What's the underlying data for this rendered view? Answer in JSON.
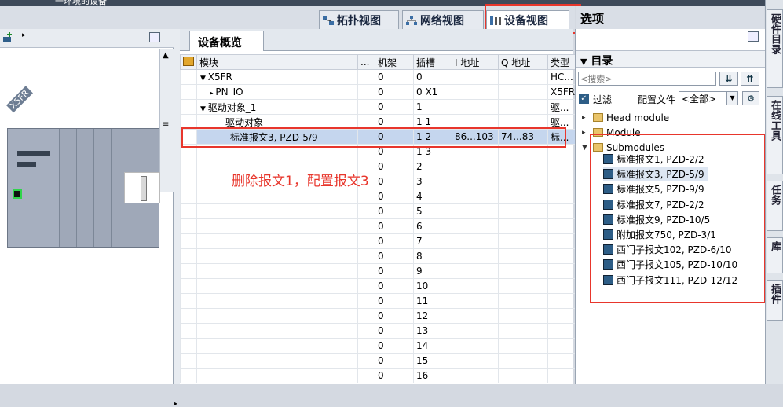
{
  "top_title_fragment": "一环境的设备",
  "view_tabs": [
    {
      "label": "拓扑视图",
      "icon": "topology-icon"
    },
    {
      "label": "网络视图",
      "icon": "network-icon"
    },
    {
      "label": "设备视图",
      "icon": "device-icon"
    }
  ],
  "options_label": "选项",
  "left": {
    "device_label": "X5FR"
  },
  "overview": {
    "tab_label": "设备概览",
    "columns": [
      "模块",
      "...",
      "机架",
      "插槽",
      "I 地址",
      "Q 地址",
      "类型"
    ],
    "rows": [
      {
        "module": "X5FR",
        "rack": "0",
        "slot": "0",
        "i": "",
        "q": "",
        "type": "HC..."
      },
      {
        "module": "PN_IO",
        "rack": "0",
        "slot": "0 X1",
        "i": "",
        "q": "",
        "type": "X5FR"
      },
      {
        "module": "驱动对象_1",
        "rack": "0",
        "slot": "1",
        "i": "",
        "q": "",
        "type": "驱..."
      },
      {
        "module": "驱动对象",
        "rack": "0",
        "slot": "1 1",
        "i": "",
        "q": "",
        "type": "驱..."
      },
      {
        "module": "标准报文3, PZD-5/9",
        "rack": "0",
        "slot": "1 2",
        "i": "86...103",
        "q": "74...83",
        "type": "标..."
      },
      {
        "module": "",
        "rack": "0",
        "slot": "1 3",
        "i": "",
        "q": "",
        "type": ""
      },
      {
        "module": "",
        "rack": "0",
        "slot": "2",
        "i": "",
        "q": "",
        "type": ""
      },
      {
        "module": "",
        "rack": "0",
        "slot": "3",
        "i": "",
        "q": "",
        "type": ""
      },
      {
        "module": "",
        "rack": "0",
        "slot": "4",
        "i": "",
        "q": "",
        "type": ""
      },
      {
        "module": "",
        "rack": "0",
        "slot": "5",
        "i": "",
        "q": "",
        "type": ""
      },
      {
        "module": "",
        "rack": "0",
        "slot": "6",
        "i": "",
        "q": "",
        "type": ""
      },
      {
        "module": "",
        "rack": "0",
        "slot": "7",
        "i": "",
        "q": "",
        "type": ""
      },
      {
        "module": "",
        "rack": "0",
        "slot": "8",
        "i": "",
        "q": "",
        "type": ""
      },
      {
        "module": "",
        "rack": "0",
        "slot": "9",
        "i": "",
        "q": "",
        "type": ""
      },
      {
        "module": "",
        "rack": "0",
        "slot": "10",
        "i": "",
        "q": "",
        "type": ""
      },
      {
        "module": "",
        "rack": "0",
        "slot": "11",
        "i": "",
        "q": "",
        "type": ""
      },
      {
        "module": "",
        "rack": "0",
        "slot": "12",
        "i": "",
        "q": "",
        "type": ""
      },
      {
        "module": "",
        "rack": "0",
        "slot": "13",
        "i": "",
        "q": "",
        "type": ""
      },
      {
        "module": "",
        "rack": "0",
        "slot": "14",
        "i": "",
        "q": "",
        "type": ""
      },
      {
        "module": "",
        "rack": "0",
        "slot": "15",
        "i": "",
        "q": "",
        "type": ""
      },
      {
        "module": "",
        "rack": "0",
        "slot": "16",
        "i": "",
        "q": "",
        "type": ""
      }
    ]
  },
  "annotation": "删除报文1，配置报文3",
  "catalog": {
    "title": "目录",
    "search_placeholder": "<搜索>",
    "filter_label": "过滤",
    "profile_label": "配置文件",
    "profile_value": "<全部>",
    "folders": [
      "Head module",
      "Module",
      "Submodules"
    ],
    "submodules": [
      "标准报文1, PZD-2/2",
      "标准报文3, PZD-5/9",
      "标准报文5, PZD-9/9",
      "标准报文7, PZD-2/2",
      "标准报文9, PZD-10/5",
      "附加报文750, PZD-3/1",
      "西门子报文102, PZD-6/10",
      "西门子报文105, PZD-10/10",
      "西门子报文111, PZD-12/12"
    ]
  },
  "sidebar_tabs": [
    "硬件目录",
    "在线工具",
    "任务",
    "库",
    "插件"
  ],
  "colors": {
    "highlight_red": "#e8362c",
    "selection": "#c5d6ee"
  }
}
